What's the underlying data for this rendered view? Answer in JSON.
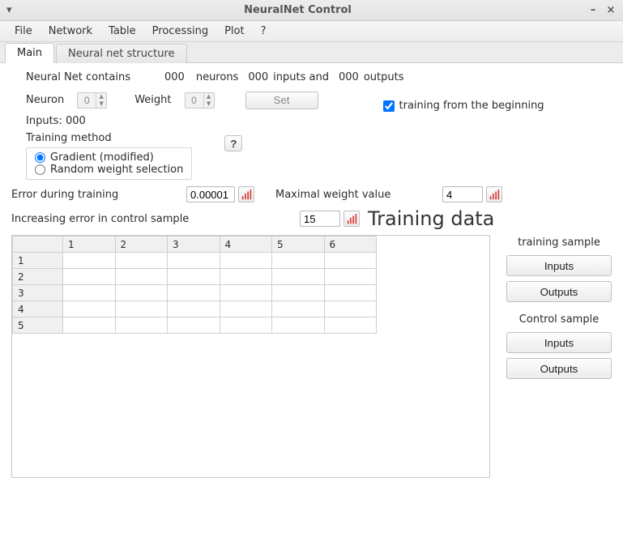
{
  "window": {
    "title": "NeuralNet Control"
  },
  "menu": {
    "items": [
      "File",
      "Network",
      "Table",
      "Processing",
      "Plot",
      "?"
    ]
  },
  "tabs": {
    "items": [
      "Main",
      "Neural net structure"
    ],
    "active_index": 0
  },
  "summary": {
    "prefix": "Neural Net contains",
    "neurons_count": "000",
    "neurons_label": "neurons",
    "inputs_count": "000",
    "inputs_label": "inputs and",
    "outputs_count": "000",
    "outputs_label": "outputs"
  },
  "neuron": {
    "label": "Neuron",
    "value": "0"
  },
  "weight": {
    "label": "Weight",
    "value": "0"
  },
  "set_button": "Set",
  "training_checkbox": {
    "label": "training from the beginning",
    "checked": true
  },
  "inputs_line": "Inputs: 000",
  "training_method": {
    "label": "Training method",
    "options": [
      "Gradient (modified)",
      "Random weight selection"
    ],
    "selected_index": 0
  },
  "help_button": "?",
  "error_training": {
    "label": "Error during training",
    "value": "0.00001"
  },
  "max_weight": {
    "label": "Maximal weight value",
    "value": "4"
  },
  "increasing_error": {
    "label": "Increasing error in control sample",
    "value": "15"
  },
  "training_data_heading": "Training data",
  "table": {
    "col_headers": [
      "1",
      "2",
      "3",
      "4",
      "5",
      "6"
    ],
    "row_headers": [
      "1",
      "2",
      "3",
      "4",
      "5"
    ]
  },
  "side": {
    "training_sample_label": "training sample",
    "control_sample_label": "Control sample",
    "inputs_btn": "Inputs",
    "outputs_btn": "Outputs"
  }
}
